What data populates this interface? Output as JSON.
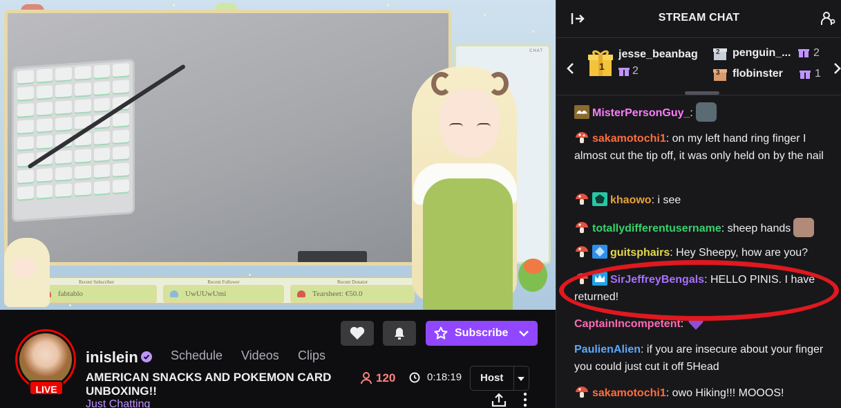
{
  "video": {
    "overlay": {
      "mini_chat_label": "CHAT",
      "recent_subscriber_label": "Recent Subscriber",
      "recent_subscriber_value": "fabtablo",
      "recent_follower_label": "Recent Follower",
      "recent_follower_value": "UwUUwUmi",
      "recent_donator_label": "Recent Donator",
      "recent_donator_value": "Tearsheet: €50.0"
    }
  },
  "chat": {
    "title": "STREAM CHAT",
    "leaderboard": [
      {
        "rank": "1",
        "name": "jesse_beanbag",
        "count": "2"
      },
      {
        "rank": "2",
        "name": "penguin_...",
        "count": "2"
      },
      {
        "rank": "3",
        "name": "flobinster",
        "count": "1"
      }
    ],
    "messages": [
      {
        "user": "MisterPersonGuy_",
        "sep": ":",
        "text": "",
        "user_color": "#ff7cfc",
        "badge": "mustache"
      },
      {
        "user": "sakamotochi1",
        "sep": ":",
        "text": " on my left hand ring finger I almost cut the tip off, it was only held on by the nail",
        "user_color": "#ff6e3c",
        "badge": "mushroom"
      },
      {
        "user": "khaowo",
        "sep": ":",
        "text": " i see",
        "user_color": "#e7a23a",
        "badge": "mushroom-teal"
      },
      {
        "user": "totallydifferentusername",
        "sep": ":",
        "text": " sheep hands",
        "user_color": "#36d36a",
        "badge": "mushroom"
      },
      {
        "user": "guitsphairs",
        "sep": ":",
        "text": " Hey Sheepy, how are you?",
        "user_color": "#e5d94c",
        "badge": "mushroom-blue"
      },
      {
        "user": "SirJeffreyBengals",
        "sep": ":",
        "text": " HELLO PINIS. I have returned!",
        "user_color": "#a970ff",
        "badge": "mushroom-crown"
      },
      {
        "user": "CaptainIncompetent",
        "sep": ":",
        "text": "",
        "user_color": "#ff69b4",
        "badge": "none"
      },
      {
        "user": "PaulienAlien",
        "sep": ":",
        "text": " if you are insecure about your finger you could just cut it off 5Head",
        "user_color": "#5ca8ff",
        "badge": "none"
      },
      {
        "user": "sakamotochi1",
        "sep": ":",
        "text": " owo Hiking!!! MOOOS!",
        "user_color": "#ff6e3c",
        "badge": "mushroom"
      }
    ]
  },
  "channel": {
    "live_label": "LIVE",
    "name": "inislein",
    "nav": [
      "Schedule",
      "Videos",
      "Clips"
    ],
    "stream_title": "AMERICAN SNACKS AND POKEMON CARD UNBOXING!!",
    "category": "Just Chatting",
    "viewers": "120",
    "uptime": "0:18:19",
    "subscribe_label": "Subscribe",
    "host_label": "Host"
  },
  "colors": {
    "accent": "#9147ff",
    "live": "#eb0400",
    "highlight_circle": "#e0181f",
    "viewer_count": "#ff8280"
  }
}
